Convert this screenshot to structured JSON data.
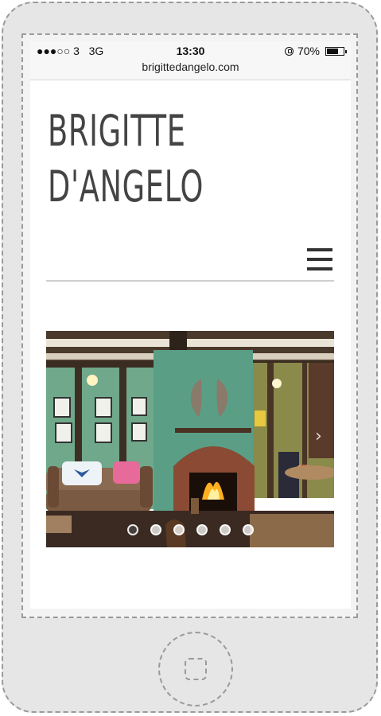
{
  "status_bar": {
    "signal_dots": "●●●○○",
    "carrier": "3",
    "network": "3G",
    "time": "13:30",
    "battery_percent": "70%",
    "battery_level": 0.7
  },
  "browser": {
    "url": "brigittedangelo.com"
  },
  "site": {
    "title_line1": "BRIGITTE",
    "title_line2": "D'ANGELO"
  },
  "menu": {
    "icon": "hamburger-menu-icon"
  },
  "slideshow": {
    "slide_count": 6,
    "active_index": 0,
    "next_icon": "chevron-right-icon"
  },
  "colors": {
    "title": "#444444",
    "divider": "#cfcfcf",
    "frame_dash": "#9a9a9a"
  }
}
